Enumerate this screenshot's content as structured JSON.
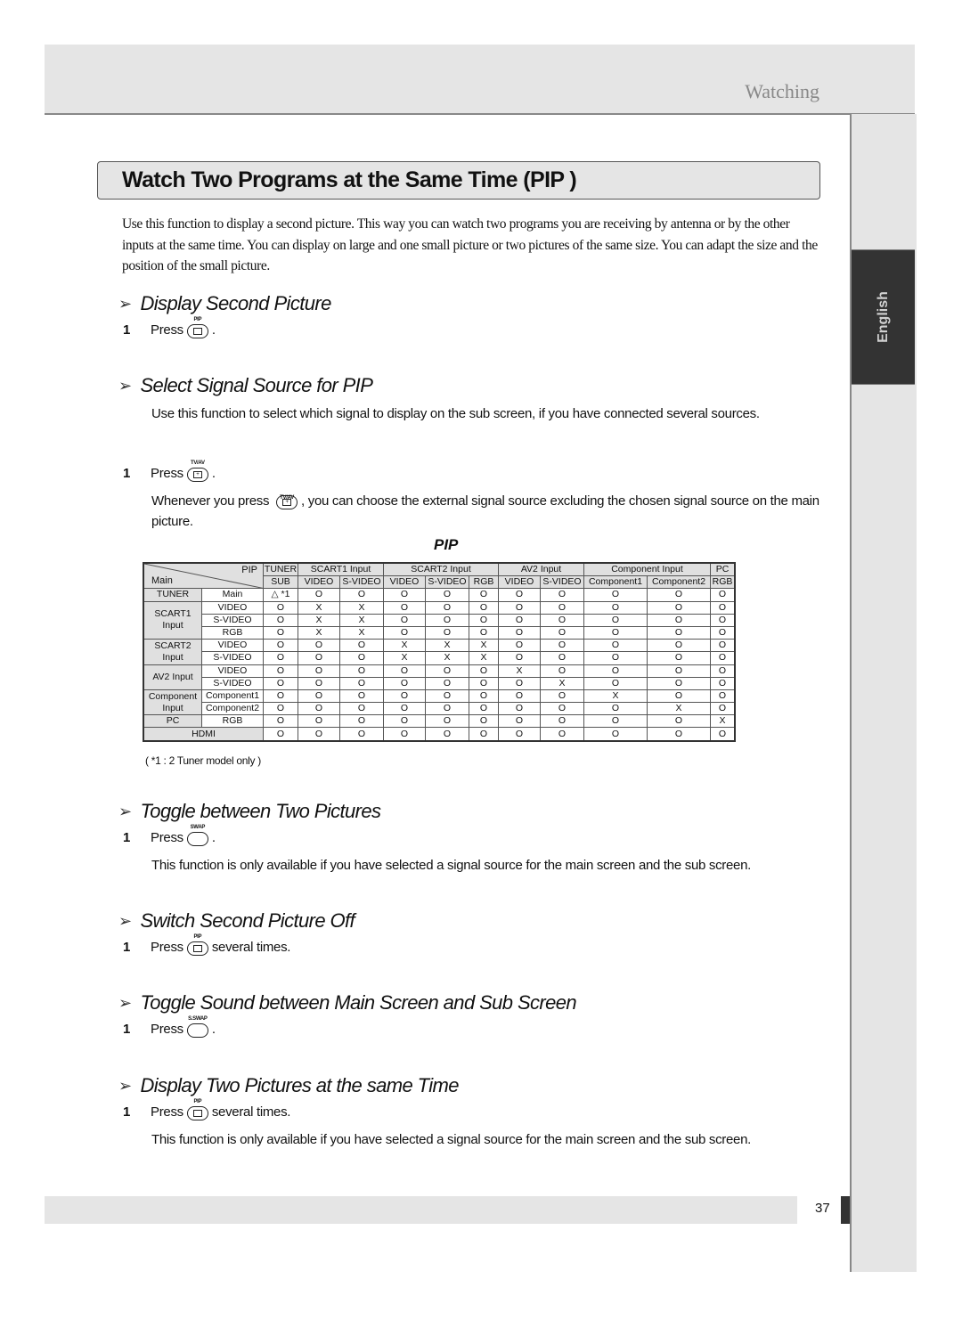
{
  "header": {
    "section": "Watching"
  },
  "side_tab": {
    "language": "English"
  },
  "title": "Watch Two Programs at the Same Time (PIP )",
  "intro": "Use this function to display a second picture. This way you can watch two programs you are receiving by antenna or by the other inputs at the same time. You can display on large and one small picture or two pictures of the same size. You can adapt the size and the position of the small picture.",
  "sections": [
    {
      "heading": "Display Second Picture",
      "step": {
        "num": "1",
        "press": "Press",
        "button": "PIP",
        "button_icon": "pip-button-icon",
        "after": "."
      }
    },
    {
      "heading": "Select Signal Source for PIP",
      "description": "Use this function to select which signal to display on the sub screen, if you have connected several sources.",
      "step": {
        "num": "1",
        "press": "Press",
        "button": "TV/AV",
        "button_icon": "tv-av-button-icon",
        "after": "."
      },
      "note_before": "Whenever you press",
      "note_after": ", you can choose the external signal source excluding the chosen signal source on the main picture."
    },
    {
      "heading": "Toggle between Two Pictures",
      "step": {
        "num": "1",
        "press": "Press",
        "button": "SWAP",
        "button_icon": "swap-button-icon",
        "after": "."
      },
      "note": "This function is only available if you have selected a signal source for the main screen and the sub screen."
    },
    {
      "heading": "Switch Second Picture Off",
      "step": {
        "num": "1",
        "press": "Press",
        "button": "PIP",
        "button_icon": "pip-button-icon",
        "after": "several times."
      }
    },
    {
      "heading": "Toggle Sound between Main Screen and Sub Screen",
      "step": {
        "num": "1",
        "press": "Press",
        "button": "S.SWAP",
        "button_icon": "sound-swap-button-icon",
        "after": "."
      }
    },
    {
      "heading": "Display Two Pictures at the same Time",
      "step": {
        "num": "1",
        "press": "Press",
        "button": "PIP",
        "button_icon": "pip-button-icon",
        "after": "several times."
      },
      "note": "This function is only available if you have selected a signal source for the main screen and the sub screen."
    }
  ],
  "pip_table": {
    "caption": "PIP",
    "corner_top": "PIP",
    "corner_bottom": "Main",
    "group_headers": [
      {
        "label": "TUNER",
        "span": 1
      },
      {
        "label": "SCART1 Input",
        "span": 2
      },
      {
        "label": "SCART2 Input",
        "span": 3
      },
      {
        "label": "AV2 Input",
        "span": 2
      },
      {
        "label": "Component Input",
        "span": 2
      },
      {
        "label": "PC",
        "span": 1
      }
    ],
    "sub_headers": [
      "SUB",
      "VIDEO",
      "S-VIDEO",
      "VIDEO",
      "S-VIDEO",
      "RGB",
      "VIDEO",
      "S-VIDEO",
      "Component1",
      "Component2",
      "RGB"
    ],
    "row_groups": [
      {
        "label": "TUNER",
        "rows": [
          {
            "label": "Main",
            "cells": [
              "△ *1",
              "O",
              "O",
              "O",
              "O",
              "O",
              "O",
              "O",
              "O",
              "O",
              "O"
            ]
          }
        ]
      },
      {
        "label": "SCART1 Input",
        "rows": [
          {
            "label": "VIDEO",
            "cells": [
              "O",
              "X",
              "X",
              "O",
              "O",
              "O",
              "O",
              "O",
              "O",
              "O",
              "O"
            ]
          },
          {
            "label": "S-VIDEO",
            "cells": [
              "O",
              "X",
              "X",
              "O",
              "O",
              "O",
              "O",
              "O",
              "O",
              "O",
              "O"
            ]
          },
          {
            "label": "RGB",
            "cells": [
              "O",
              "X",
              "X",
              "O",
              "O",
              "O",
              "O",
              "O",
              "O",
              "O",
              "O"
            ]
          }
        ]
      },
      {
        "label": "SCART2 Input",
        "rows": [
          {
            "label": "VIDEO",
            "cells": [
              "O",
              "O",
              "O",
              "X",
              "X",
              "X",
              "O",
              "O",
              "O",
              "O",
              "O"
            ]
          },
          {
            "label": "S-VIDEO",
            "cells": [
              "O",
              "O",
              "O",
              "X",
              "X",
              "X",
              "O",
              "O",
              "O",
              "O",
              "O"
            ]
          }
        ]
      },
      {
        "label": "AV2 Input",
        "rows": [
          {
            "label": "VIDEO",
            "cells": [
              "O",
              "O",
              "O",
              "O",
              "O",
              "O",
              "X",
              "O",
              "O",
              "O",
              "O"
            ]
          },
          {
            "label": "S-VIDEO",
            "cells": [
              "O",
              "O",
              "O",
              "O",
              "O",
              "O",
              "O",
              "X",
              "O",
              "O",
              "O"
            ]
          }
        ]
      },
      {
        "label": "Component Input",
        "rows": [
          {
            "label": "Component1",
            "cells": [
              "O",
              "O",
              "O",
              "O",
              "O",
              "O",
              "O",
              "O",
              "X",
              "O",
              "O"
            ]
          },
          {
            "label": "Component2",
            "cells": [
              "O",
              "O",
              "O",
              "O",
              "O",
              "O",
              "O",
              "O",
              "O",
              "X",
              "O"
            ]
          }
        ]
      },
      {
        "label": "PC",
        "rows": [
          {
            "label": "RGB",
            "cells": [
              "O",
              "O",
              "O",
              "O",
              "O",
              "O",
              "O",
              "O",
              "O",
              "O",
              "X"
            ]
          }
        ]
      },
      {
        "label": "HDMI",
        "full_span": true,
        "rows": [
          {
            "label": "",
            "cells": [
              "O",
              "O",
              "O",
              "O",
              "O",
              "O",
              "O",
              "O",
              "O",
              "O",
              "O"
            ]
          }
        ]
      }
    ],
    "footnote": "( *1 :  2 Tuner model only )"
  },
  "footer": {
    "page_number": "37"
  }
}
